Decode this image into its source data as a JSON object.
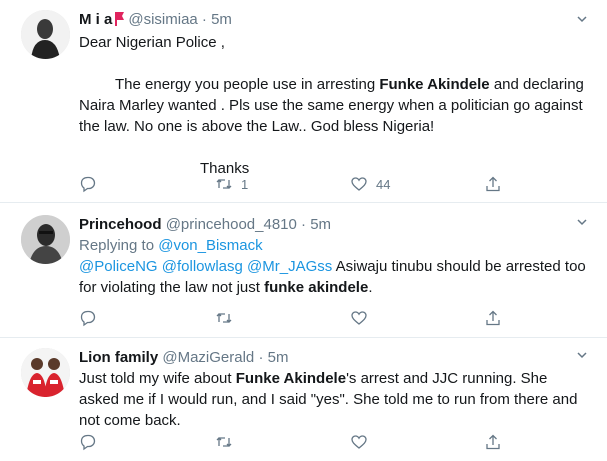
{
  "tweets": [
    {
      "name": "M i a",
      "handle": "@sisimiaa",
      "time": "5m",
      "paragraphs": [
        "Dear Nigerian Police ,",
        "The energy you people use in arresting {Funke Akindele} and declaring Naira Marley wanted . Pls use the same energy when a politician go against the law. No one is above the Law.. God bless Nigeria!",
        "Thanks"
      ],
      "actions": {
        "reply": "",
        "retweet": "1",
        "like": "44",
        "share": ""
      }
    },
    {
      "name": "Princehood",
      "handle": "@princehood_4810",
      "time": "5m",
      "replying_label": "Replying to",
      "replying_to": "@von_Bismack",
      "text": "@PoliceNG @followlasg @Mr_JAGss Asiwaju tinubu should be arrested too for violating the law not just {funke akindele}.",
      "actions": {
        "reply": "",
        "retweet": "",
        "like": "",
        "share": ""
      }
    },
    {
      "name": "Lion family",
      "handle": "@MaziGerald",
      "time": "5m",
      "text": "Just told my wife about {Funke Akindele}'s arrest and JJC running. She asked me if I would run, and I said \"yes\". She told me to run from there and not come back.",
      "actions": {
        "reply": "",
        "retweet": "",
        "like": "",
        "share": ""
      }
    }
  ],
  "dot": "·",
  "colors": {
    "accent": "#1b95e0",
    "muted": "#657786",
    "text": "#14171a",
    "border": "#e6ecf0",
    "flag_red": "#e0245e"
  },
  "icons": [
    "reply-icon",
    "retweet-icon",
    "like-icon",
    "share-icon",
    "caret-down-icon",
    "flag-icon"
  ]
}
